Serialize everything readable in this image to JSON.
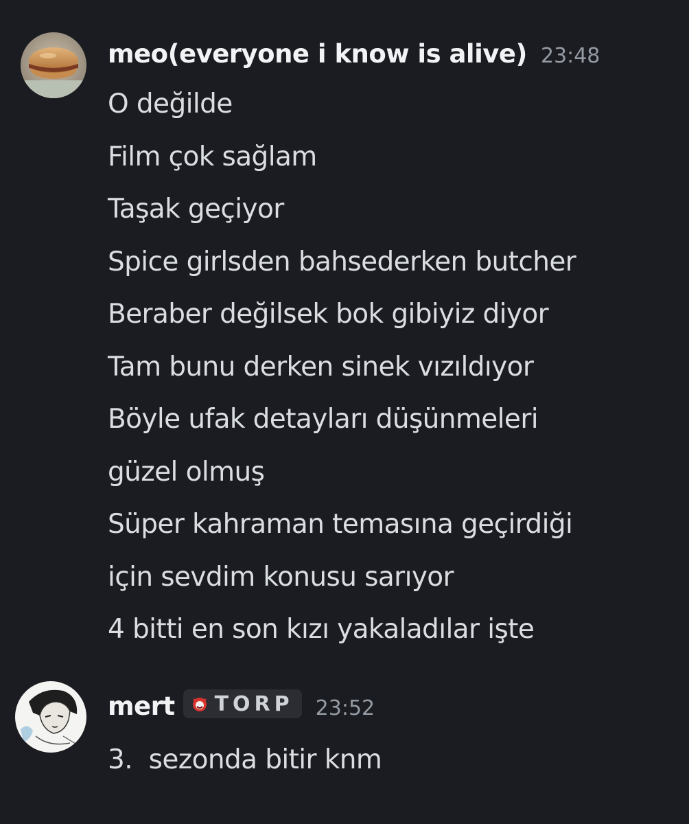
{
  "messages": [
    {
      "username": "meo(everyone i know is alive)",
      "timestamp": "23:48",
      "avatar_icon": "sandwich-avatar",
      "lines": [
        "O değilde",
        "Film çok sağlam",
        "Taşak geçiyor",
        "Spice girlsden bahsederken butcher",
        "Beraber değilsek bok gibiyiz diyor",
        "Tam bunu derken sinek vızıldıyor",
        "Böyle ufak detayları düşünmeleri",
        "güzel olmuş",
        "Süper kahraman temasına geçirdiği",
        "için sevdim konusu sarıyor",
        "4 bitti en son kızı yakaladılar işte"
      ]
    },
    {
      "username": "mert",
      "timestamp": "23:52",
      "avatar_icon": "manga-character-avatar",
      "tag": {
        "icon": "red-creature-icon",
        "text": "TORP"
      },
      "lines": [
        "3.  sezonda bitir knm"
      ]
    }
  ]
}
